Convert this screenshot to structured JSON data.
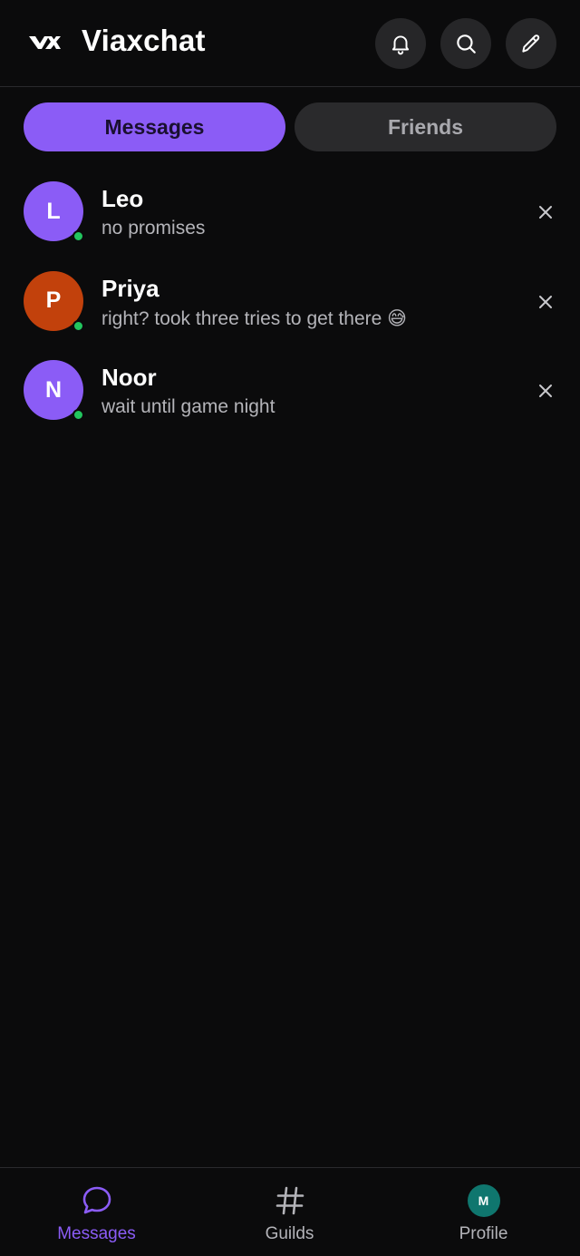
{
  "header": {
    "title": "Viaxchat",
    "logo_icon": "viaxchat-logo",
    "actions": [
      {
        "icon": "bell-icon"
      },
      {
        "icon": "search-icon"
      },
      {
        "icon": "pencil-icon"
      }
    ]
  },
  "tabs": [
    {
      "label": "Messages",
      "active": true
    },
    {
      "label": "Friends",
      "active": false
    }
  ],
  "conversations": [
    {
      "initial": "L",
      "name": "Leo",
      "preview": "no promises",
      "avatar_color": "#8b5cf6",
      "online": true
    },
    {
      "initial": "P",
      "name": "Priya",
      "preview": "right? took three tries to get there 😅",
      "avatar_color": "#c2410c",
      "online": true
    },
    {
      "initial": "N",
      "name": "Noor",
      "preview": "wait until game night",
      "avatar_color": "#8b5cf6",
      "online": true
    }
  ],
  "bottom_nav": [
    {
      "label": "Messages",
      "icon": "chat-bubble-icon",
      "active": true
    },
    {
      "label": "Guilds",
      "icon": "hash-icon",
      "active": false
    },
    {
      "label": "Profile",
      "avatar_initial": "M",
      "active": false
    }
  ],
  "colors": {
    "accent": "#8b5cf6",
    "background": "#0b0b0c",
    "presence_online": "#22c55e",
    "profile_avatar": "#0f766e"
  }
}
